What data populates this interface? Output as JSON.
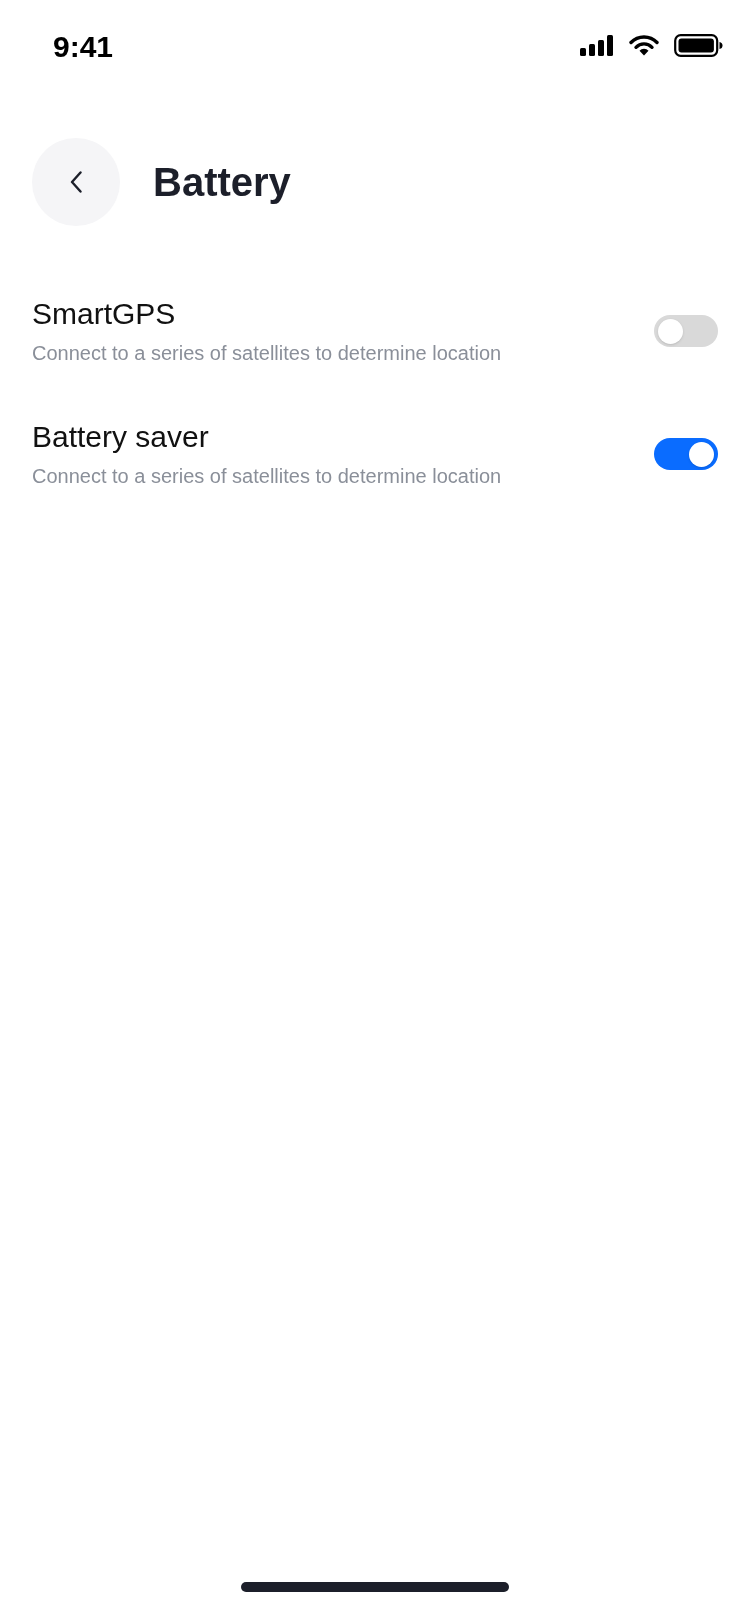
{
  "status_bar": {
    "time": "9:41"
  },
  "header": {
    "title": "Battery"
  },
  "settings": [
    {
      "title": "SmartGPS",
      "description": "Connect to a series of satellites to determine location",
      "on": false
    },
    {
      "title": "Battery saver",
      "description": "Connect to a series of satellites to determine location",
      "on": true
    }
  ]
}
